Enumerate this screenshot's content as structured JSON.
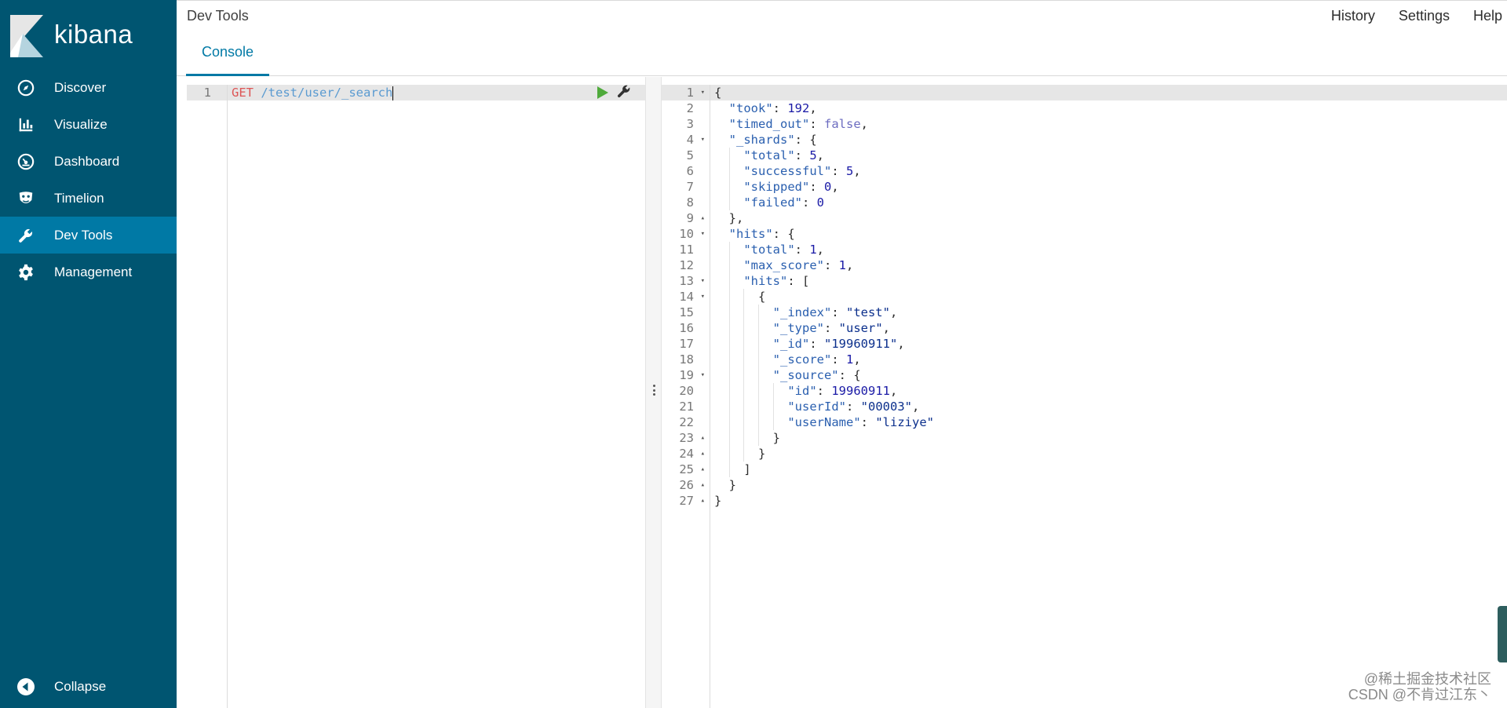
{
  "app": {
    "logo_text": "kibana",
    "brand_color": "#005571",
    "active_color": "#0079a5"
  },
  "sidebar": {
    "items": [
      {
        "label": "Discover",
        "icon": "compass-icon"
      },
      {
        "label": "Visualize",
        "icon": "bar-chart-icon"
      },
      {
        "label": "Dashboard",
        "icon": "dashboard-icon"
      },
      {
        "label": "Timelion",
        "icon": "timelion-mask-icon"
      },
      {
        "label": "Dev Tools",
        "icon": "wrench-icon",
        "active": true
      },
      {
        "label": "Management",
        "icon": "gear-icon"
      }
    ],
    "collapse_label": "Collapse"
  },
  "header": {
    "title": "Dev Tools",
    "links": [
      "History",
      "Settings",
      "Help"
    ],
    "tabs": [
      {
        "label": "Console"
      }
    ]
  },
  "request": {
    "line_number": "1",
    "method": "GET",
    "path": "/test/user/_search"
  },
  "response": {
    "lines": [
      "{",
      "  \"took\": 192,",
      "  \"timed_out\": false,",
      "  \"_shards\": {",
      "    \"total\": 5,",
      "    \"successful\": 5,",
      "    \"skipped\": 0,",
      "    \"failed\": 0",
      "  },",
      "  \"hits\": {",
      "    \"total\": 1,",
      "    \"max_score\": 1,",
      "    \"hits\": [",
      "      {",
      "        \"_index\": \"test\",",
      "        \"_type\": \"user\",",
      "        \"_id\": \"19960911\",",
      "        \"_score\": 1,",
      "        \"_source\": {",
      "          \"id\": 19960911,",
      "          \"userId\": \"00003\",",
      "          \"userName\": \"liziye\"",
      "        }",
      "      }",
      "    ]",
      "  }",
      "}"
    ],
    "fold_markers": {
      "1": "open",
      "4": "open",
      "9": "close",
      "10": "open",
      "13": "open",
      "14": "open",
      "19": "open",
      "23": "close",
      "24": "close",
      "25": "close",
      "26": "close",
      "27": "close"
    }
  },
  "watermark": {
    "line1": "@稀土掘金技术社区",
    "line2": "CSDN @不肯过江东丶"
  }
}
